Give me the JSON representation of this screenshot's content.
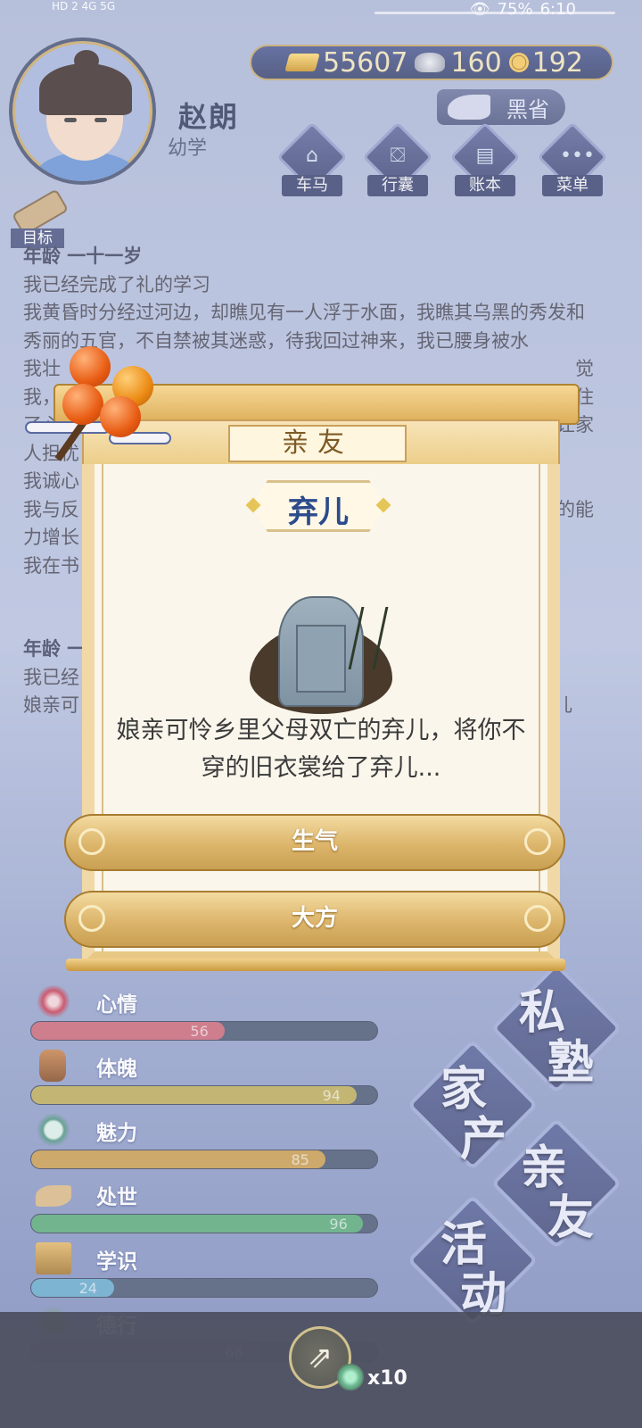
{
  "status": {
    "left": "HD 2  4G  5G",
    "battery": "75%",
    "time": "6:10"
  },
  "player": {
    "name": "赵朗",
    "rank": "幼学"
  },
  "currency": {
    "gold": "55607",
    "silver": "160",
    "coin": "192"
  },
  "heisheng_label": "黑省",
  "top_buttons": [
    {
      "label": "车马",
      "icon": "carriage-icon"
    },
    {
      "label": "行囊",
      "icon": "bag-icon"
    },
    {
      "label": "账本",
      "icon": "ledger-icon"
    },
    {
      "label": "菜单",
      "icon": "menu-icon"
    }
  ],
  "goal_label": "目标",
  "story": {
    "age1": "年龄 一十一岁",
    "p1": "我已经完成了礼的学习",
    "p2": "我黄昏时分经过河边，却瞧见有一人浮于水面，我瞧其乌黑的秀发和秀丽的五官，不自禁被其迷惑，待我回过神来，我已腰身被水",
    "p3": "我壮",
    "p3_right": "觉",
    "p4": "我，",
    "p4_right": "慑住",
    "p5": "了心神",
    "p5_right": "让家",
    "p6": "人担忧",
    "p7": "我诚心",
    "p8": "我与反",
    "p8_right": "的能",
    "p9": "力增长",
    "p10": "我在书",
    "age2": "年龄 一",
    "p11": "我已经",
    "p12": "娘亲可",
    "p12_right": "儿"
  },
  "modal": {
    "category": "亲友",
    "event_title": "弃儿",
    "event_text": "娘亲可怜乡里父母双亡的弃儿，将你不穿的旧衣裳给了弃儿...",
    "choices": [
      "生气",
      "大方"
    ]
  },
  "stats": [
    {
      "name": "心情",
      "value": 56,
      "color": "#c75b6c",
      "icon": "flower-icon"
    },
    {
      "name": "体魄",
      "value": 94,
      "color": "#b7a64a",
      "icon": "drum-icon"
    },
    {
      "name": "魅力",
      "value": 85,
      "color": "#c6953f",
      "icon": "mirror-icon"
    },
    {
      "name": "处世",
      "value": 96,
      "color": "#4ba36c",
      "icon": "hand-icon"
    },
    {
      "name": "学识",
      "value": 24,
      "color": "#5aa3c7",
      "icon": "books-icon"
    },
    {
      "name": "德行",
      "value": 66,
      "color": "#6b5aa0",
      "icon": "vase-icon"
    }
  ],
  "right_buttons": [
    {
      "t1": "私",
      "t2": "塾"
    },
    {
      "t1": "家",
      "t2": "产"
    },
    {
      "t1": "亲",
      "t2": "友"
    },
    {
      "t1": "活",
      "t2": "动"
    }
  ],
  "share_multiplier": "x10"
}
